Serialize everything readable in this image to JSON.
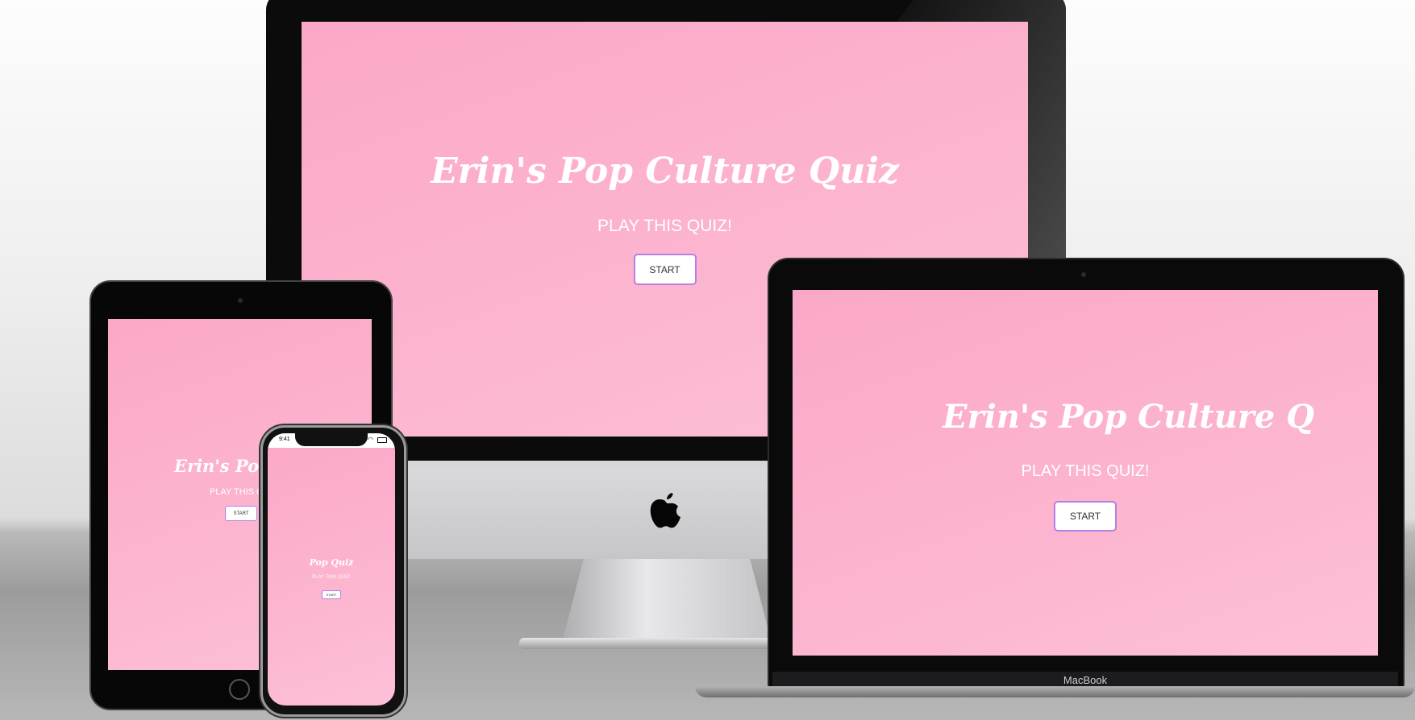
{
  "quiz": {
    "title": "Erin's Pop Culture Quiz",
    "subtitle": "PLAY THIS QUIZ!",
    "start_label": "START"
  },
  "laptop": {
    "title_visible": "Erin's Pop Culture Q",
    "brand_label": "MacBook"
  },
  "tablet": {
    "title_visible": "Erin's Pop C",
    "subtitle_visible": "PLAY THIS QU"
  },
  "phone": {
    "title_visible": "Pop Quiz",
    "status_time": "9:41"
  },
  "colors": {
    "screen_pink": "#fcb4cf",
    "button_border": "#b77fe6",
    "text": "#ffffff"
  }
}
